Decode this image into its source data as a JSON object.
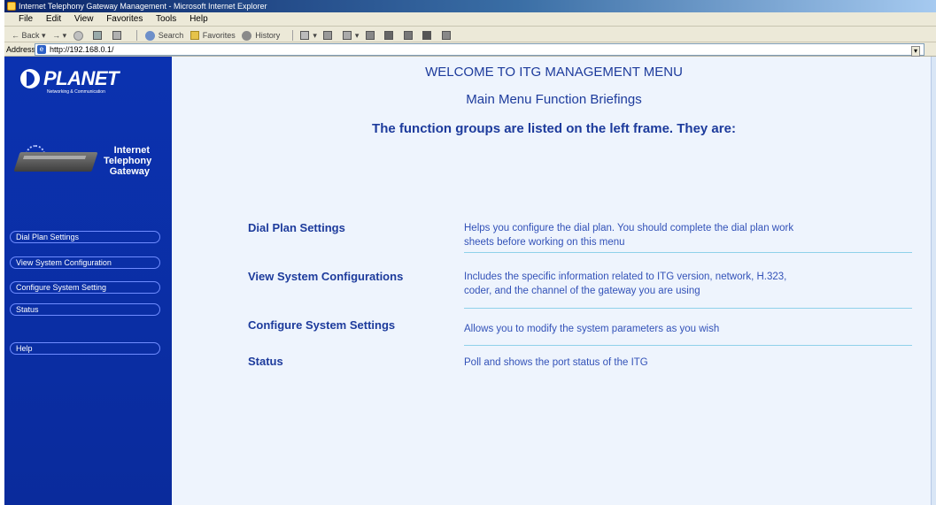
{
  "window": {
    "title": "Internet Telephony Gateway Management - Microsoft Internet Explorer"
  },
  "menubar": {
    "items": [
      "File",
      "Edit",
      "View",
      "Favorites",
      "Tools",
      "Help"
    ]
  },
  "toolbar": {
    "back_label": "Back",
    "search_label": "Search",
    "favorites_label": "Favorites",
    "history_label": "History"
  },
  "addressbar": {
    "label": "Address",
    "url": "http://192.168.0.1/"
  },
  "sidebar": {
    "logo_text": "PLANET",
    "logo_sub": "Networking & Communication",
    "product_name_1": "Internet",
    "product_name_2": "Telephony",
    "product_name_3": "Gateway",
    "items": [
      {
        "label": "Dial Plan Settings"
      },
      {
        "label": "View System Configuration"
      },
      {
        "label": "Configure System Setting"
      },
      {
        "label": "Status"
      },
      {
        "label": "Help"
      }
    ]
  },
  "main": {
    "welcome": "WELCOME TO ITG MANAGEMENT MENU",
    "subtitle": "Main Menu Function Briefings",
    "intro": "The function groups are listed on the left frame. They are:",
    "functions": [
      {
        "name": "Dial Plan Settings",
        "desc_1": "Helps you configure the dial plan. You should complete the dial plan work",
        "desc_2": "sheets before working on this menu"
      },
      {
        "name": "View System Configurations",
        "desc_1": "Includes the specific information related to ITG version, network, H.323,",
        "desc_2": "coder, and the channel of the gateway you are using"
      },
      {
        "name": "Configure System Settings",
        "desc_1": "Allows you to modify the system parameters as you wish"
      },
      {
        "name": "Status",
        "desc_1": "Poll and shows the port status of the ITG"
      }
    ]
  },
  "colors": {
    "sidebar_bg": "#0b32b0",
    "content_bg": "#eef4fd",
    "heading": "#1d3b9c",
    "separator": "#8fd1ea"
  }
}
